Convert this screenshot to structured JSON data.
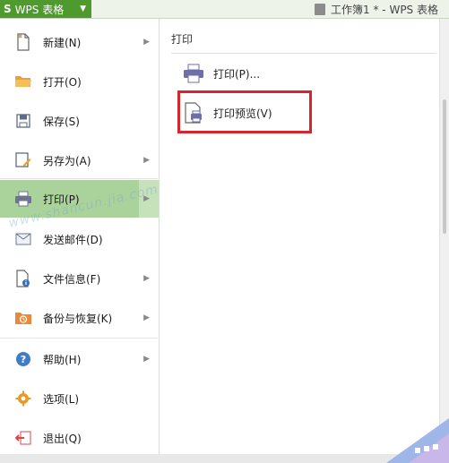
{
  "titlebar": {
    "app_logo": "S",
    "app_name": "WPS 表格",
    "doc_title": "工作簿1 * - WPS 表格"
  },
  "menu": {
    "items": [
      {
        "label": "新建(N)",
        "icon": "new-file-icon",
        "has_submenu": true
      },
      {
        "label": "打开(O)",
        "icon": "open-folder-icon",
        "has_submenu": false
      },
      {
        "label": "保存(S)",
        "icon": "save-icon",
        "has_submenu": false
      },
      {
        "label": "另存为(A)",
        "icon": "save-as-icon",
        "has_submenu": true
      },
      {
        "label": "打印(P)",
        "icon": "printer-icon",
        "has_submenu": true,
        "selected": true
      },
      {
        "label": "发送邮件(D)",
        "icon": "mail-icon",
        "has_submenu": false
      },
      {
        "label": "文件信息(F)",
        "icon": "file-info-icon",
        "has_submenu": true
      },
      {
        "label": "备份与恢复(K)",
        "icon": "backup-icon",
        "has_submenu": true
      },
      {
        "label": "帮助(H)",
        "icon": "help-icon",
        "has_submenu": true
      },
      {
        "label": "选项(L)",
        "icon": "options-gear-icon",
        "has_submenu": false
      },
      {
        "label": "退出(Q)",
        "icon": "exit-icon",
        "has_submenu": false
      }
    ]
  },
  "panel": {
    "title": "打印",
    "items": [
      {
        "label": "打印(P)...",
        "icon": "printer-icon"
      },
      {
        "label": "打印预览(V)",
        "icon": "print-preview-icon"
      }
    ]
  },
  "watermark": "www.shancun.jia.com",
  "colors": {
    "accent": "#4f9a2e",
    "selected": "#a9d39a",
    "highlight_box": "#d7262b"
  }
}
